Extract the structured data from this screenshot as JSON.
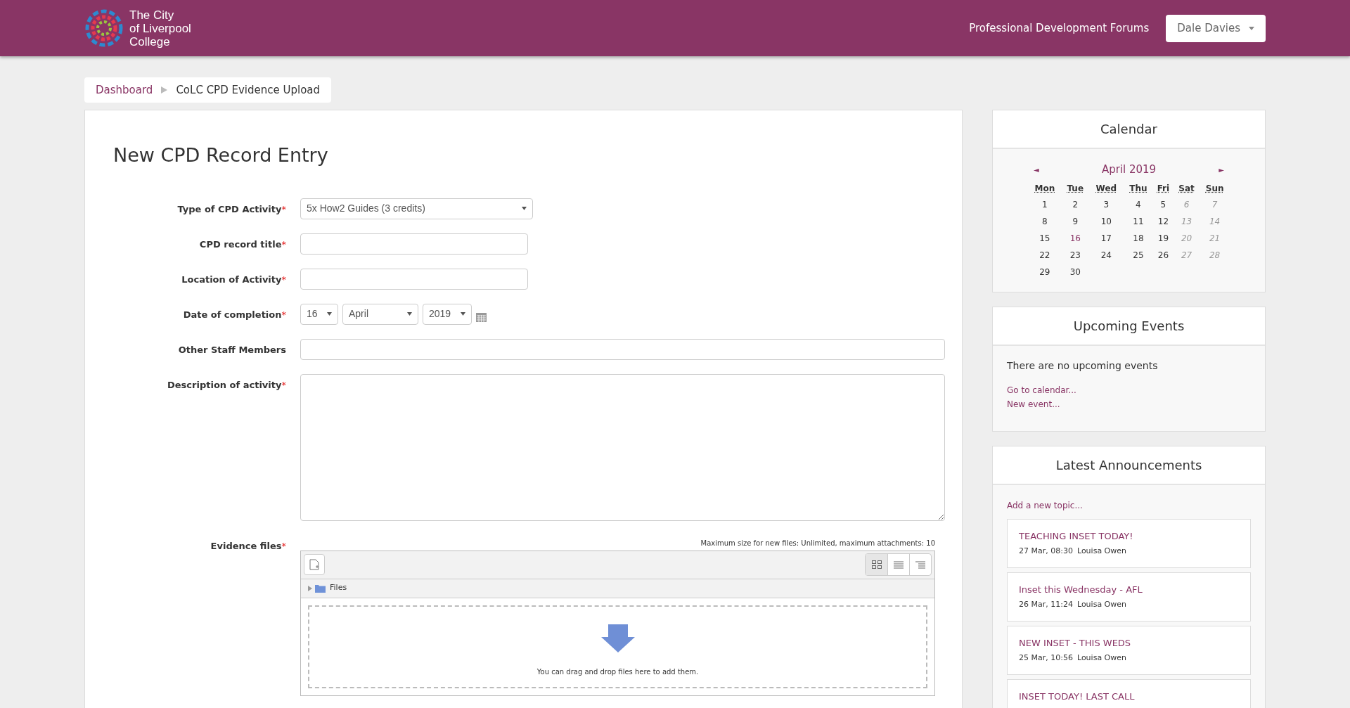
{
  "header": {
    "logo_text": [
      "The City",
      "of Liverpool",
      "College"
    ],
    "nav_link": "Professional Development Forums",
    "user_menu": "Dale Davies"
  },
  "breadcrumb": [
    {
      "label": "Dashboard",
      "kind": "link"
    },
    {
      "label": "CoLC CPD Evidence Upload",
      "kind": "current"
    }
  ],
  "form": {
    "title": "New CPD Record Entry",
    "fields": [
      {
        "kind": "select",
        "label": "Type of CPD Activity",
        "required_mark": "*",
        "value": "5x How2 Guides (3 credits)"
      },
      {
        "kind": "short_text",
        "label": "CPD record title",
        "required_mark": "*"
      },
      {
        "kind": "short_text",
        "label": "Location of Activity",
        "required_mark": "*"
      },
      {
        "kind": "date",
        "label": "Date of completion",
        "required_mark": "*",
        "day": "16",
        "month": "April",
        "year": "2019"
      },
      {
        "kind": "wide_text",
        "label": "Other Staff Members"
      },
      {
        "kind": "textarea",
        "label": "Description of activity",
        "required_mark": "*"
      },
      {
        "kind": "files",
        "label": "Evidence files",
        "required_mark": "*",
        "limits": "Maximum size for new files: Unlimited, maximum attachments: 10",
        "folder": "Files",
        "drop_hint": "You can drag and drop files here to add them."
      }
    ]
  },
  "calendar": {
    "title": "Calendar",
    "prev": "◄",
    "next": "►",
    "month": "April 2019",
    "weekdays": [
      "Mon",
      "Tue",
      "Wed",
      "Thu",
      "Fri",
      "Sat",
      "Sun"
    ],
    "weeks": [
      [
        {
          "day": "1",
          "weekend": false,
          "today": false
        },
        {
          "day": "2",
          "weekend": false,
          "today": false
        },
        {
          "day": "3",
          "weekend": false,
          "today": false
        },
        {
          "day": "4",
          "weekend": false,
          "today": false
        },
        {
          "day": "5",
          "weekend": false,
          "today": false
        },
        {
          "day": "6",
          "weekend": true,
          "today": false
        },
        {
          "day": "7",
          "weekend": true,
          "today": false
        }
      ],
      [
        {
          "day": "8",
          "weekend": false,
          "today": false
        },
        {
          "day": "9",
          "weekend": false,
          "today": false
        },
        {
          "day": "10",
          "weekend": false,
          "today": false
        },
        {
          "day": "11",
          "weekend": false,
          "today": false
        },
        {
          "day": "12",
          "weekend": false,
          "today": false
        },
        {
          "day": "13",
          "weekend": true,
          "today": false
        },
        {
          "day": "14",
          "weekend": true,
          "today": false
        }
      ],
      [
        {
          "day": "15",
          "weekend": false,
          "today": false
        },
        {
          "day": "16",
          "weekend": false,
          "today": true
        },
        {
          "day": "17",
          "weekend": false,
          "today": false
        },
        {
          "day": "18",
          "weekend": false,
          "today": false
        },
        {
          "day": "19",
          "weekend": false,
          "today": false
        },
        {
          "day": "20",
          "weekend": true,
          "today": false
        },
        {
          "day": "21",
          "weekend": true,
          "today": false
        }
      ],
      [
        {
          "day": "22",
          "weekend": false,
          "today": false
        },
        {
          "day": "23",
          "weekend": false,
          "today": false
        },
        {
          "day": "24",
          "weekend": false,
          "today": false
        },
        {
          "day": "25",
          "weekend": false,
          "today": false
        },
        {
          "day": "26",
          "weekend": false,
          "today": false
        },
        {
          "day": "27",
          "weekend": true,
          "today": false
        },
        {
          "day": "28",
          "weekend": true,
          "today": false
        }
      ],
      [
        {
          "day": "29",
          "weekend": false,
          "today": false
        },
        {
          "day": "30",
          "weekend": false,
          "today": false
        }
      ]
    ]
  },
  "upcoming_events": {
    "title": "Upcoming Events",
    "message": "There are no upcoming events",
    "links": [
      "Go to calendar...",
      "New event..."
    ]
  },
  "announcements": {
    "title": "Latest Announcements",
    "add_link": "Add a new topic...",
    "posts": [
      {
        "title": "TEACHING INSET TODAY!",
        "date": "27 Mar, 08:30",
        "author": "Louisa Owen"
      },
      {
        "title": "Inset this Wednesday - AFL",
        "date": "26 Mar, 11:24",
        "author": "Louisa Owen"
      },
      {
        "title": "NEW INSET - THIS WEDS",
        "date": "25 Mar, 10:56",
        "author": "Louisa Owen"
      },
      {
        "title": "INSET TODAY! LAST CALL"
      }
    ]
  }
}
